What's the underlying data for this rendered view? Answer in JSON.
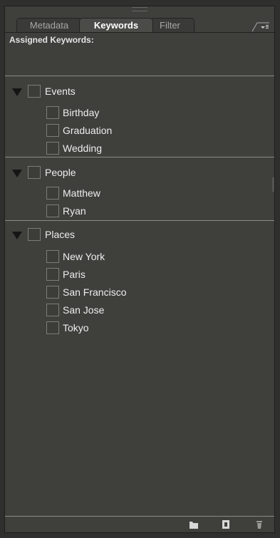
{
  "tabs": [
    {
      "label": "Metadata",
      "active": false
    },
    {
      "label": "Keywords",
      "active": true
    },
    {
      "label": "Filter",
      "active": false
    }
  ],
  "assigned_keywords_label": "Assigned Keywords:",
  "groups": [
    {
      "label": "Events",
      "children": [
        "Birthday",
        "Graduation",
        "Wedding"
      ]
    },
    {
      "label": "People",
      "children": [
        "Matthew",
        "Ryan"
      ]
    },
    {
      "label": "Places",
      "children": [
        "New York",
        "Paris",
        "San Francisco",
        "San Jose",
        "Tokyo"
      ]
    }
  ],
  "footer_icons": [
    "new-keyword-set-icon",
    "new-keyword-icon",
    "delete-icon"
  ],
  "colors": {
    "panel_bg": "#3f3f3c",
    "outer_bg": "#2f2f2d",
    "divider": "#8a8a86",
    "text": "#eeeeee"
  }
}
